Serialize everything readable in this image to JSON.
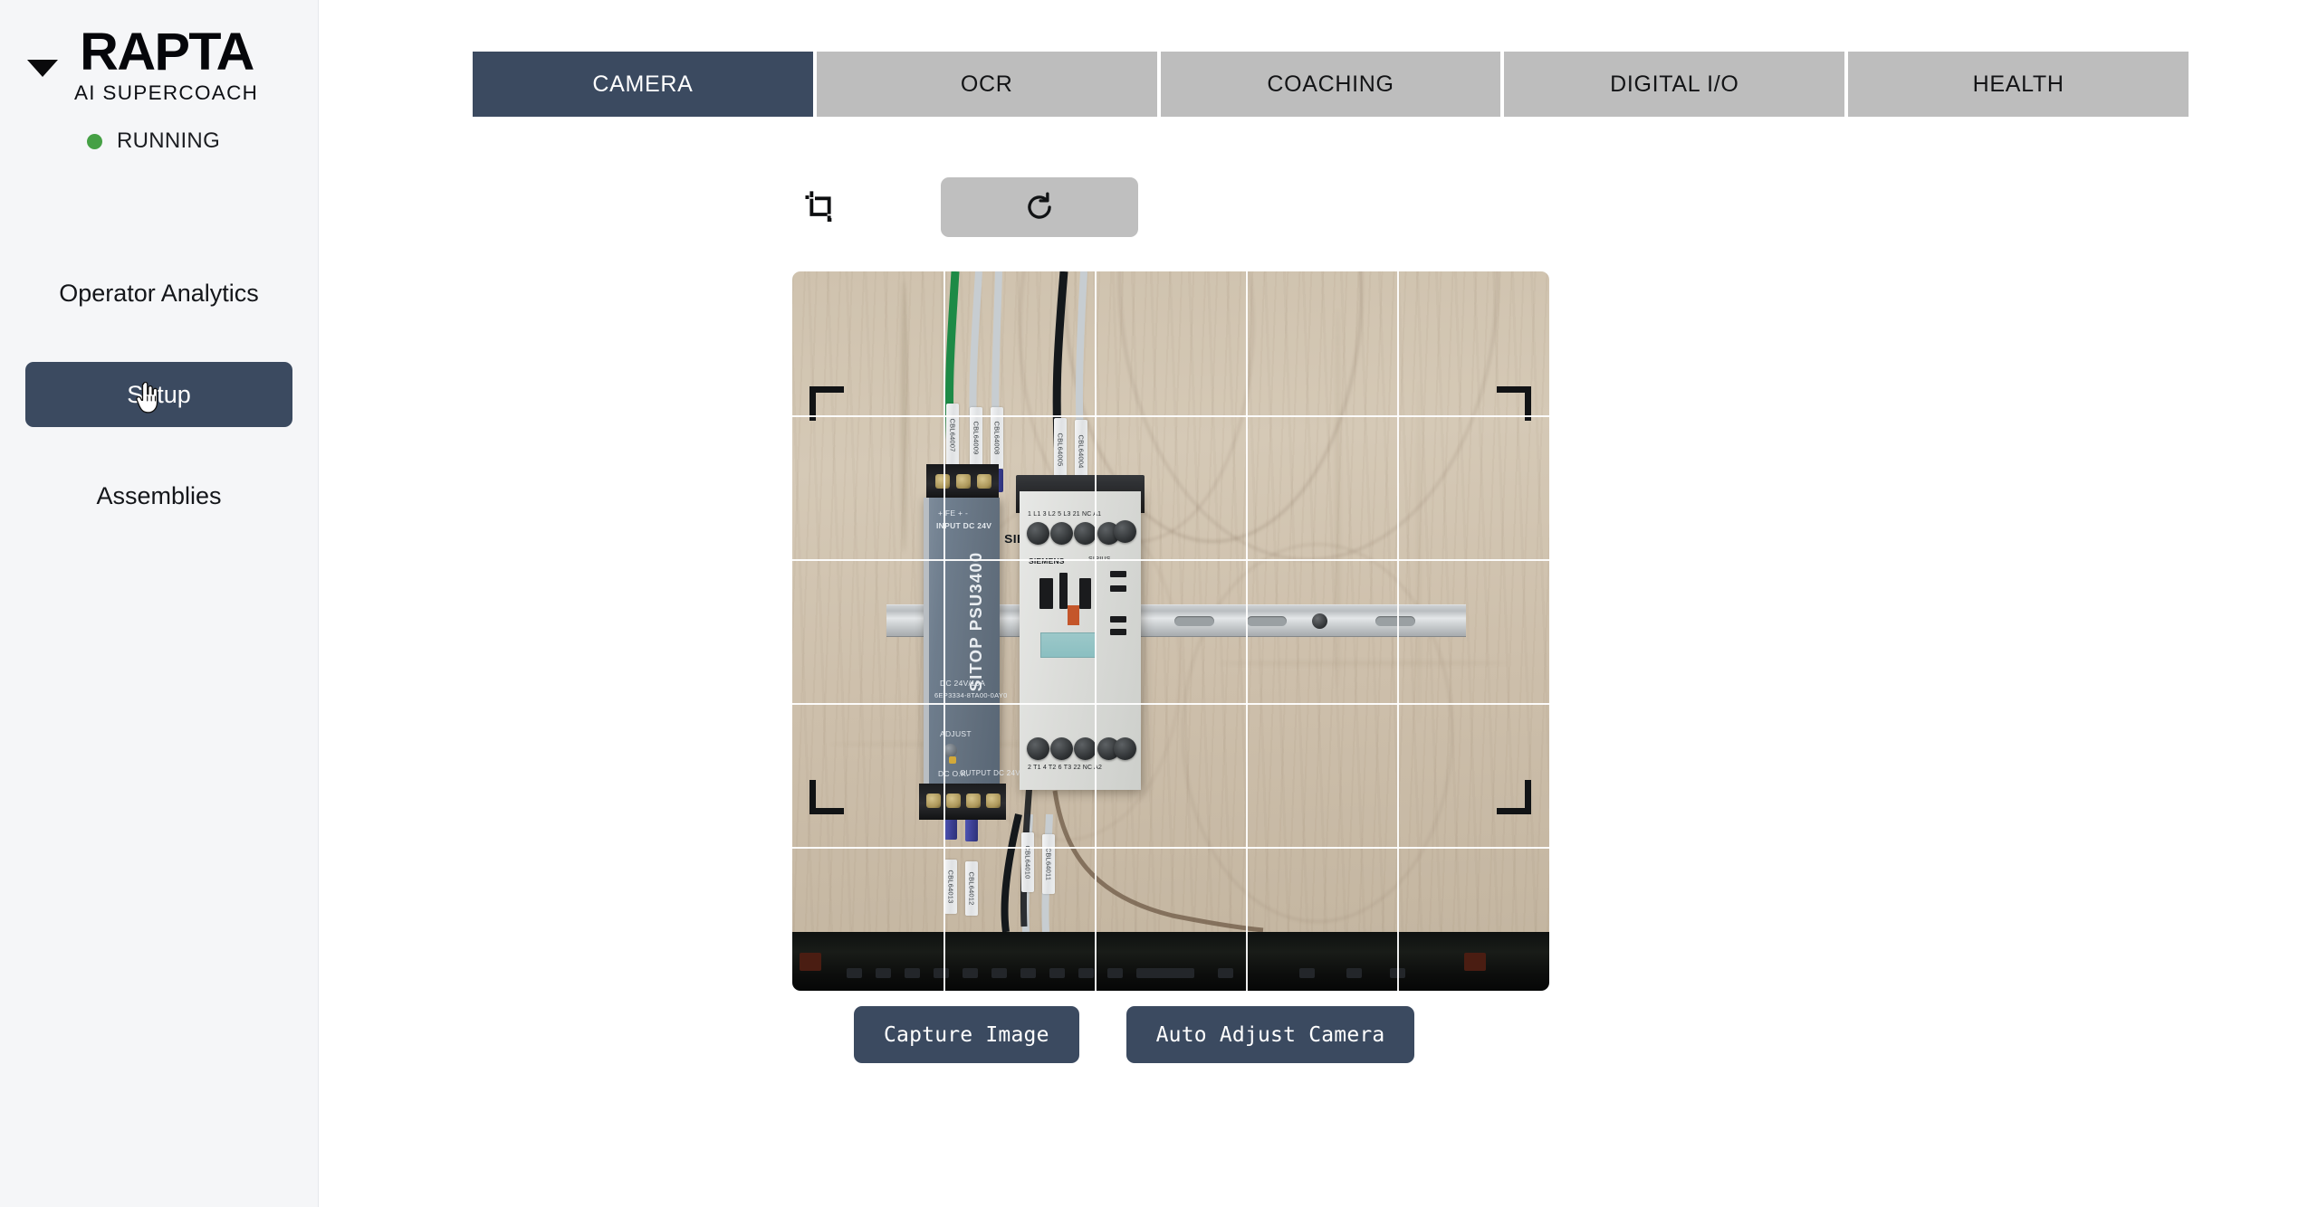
{
  "sidebar": {
    "collapse_icon": "chevron-down-icon",
    "logo_word": "RAPTA",
    "logo_sub": "AI SUPERCOACH",
    "status": {
      "label": "RUNNING",
      "color": "#45a045"
    },
    "nav_items": [
      {
        "label": "Operator Analytics",
        "active": false
      },
      {
        "label": "Setup",
        "active": true
      },
      {
        "label": "Assemblies",
        "active": false
      }
    ],
    "cursor": "pointing-hand-cursor"
  },
  "tabs": [
    {
      "label": "CAMERA",
      "active": true
    },
    {
      "label": "OCR",
      "active": false
    },
    {
      "label": "COACHING",
      "active": false
    },
    {
      "label": "DIGITAL I/O",
      "active": false
    },
    {
      "label": "HEALTH",
      "active": false
    }
  ],
  "toolbar": {
    "crop_icon": "crop-icon",
    "rotate_icon": "rotate-refresh-icon"
  },
  "camera": {
    "grid": {
      "columns": 5,
      "rows": 5,
      "line_color": "#ffffff"
    },
    "corner_markers": 4,
    "scene_labels": {
      "psu_model": "SITOP PSU3400",
      "psu_brand": "SIEMENS",
      "psu_input": "INPUT DC 24V",
      "psu_output": "OUTPUT DC 24V/10A",
      "psu_rating": "DC 24V/10A",
      "psu_partno": "6EP3334-8TA00-0AY0",
      "psu_adjust": "ADJUST",
      "psu_dcok": "DC O.K.",
      "psu_terminals": "+ FE + -",
      "contactor_brand": "SIEMENS",
      "contactor_series": "SIRIUS",
      "contactor_top_terms": "1 L1   3 L2   5 L3   21 NC   A1",
      "contactor_bot_terms": "2 T1   4 T2   6 T3   22 NC   A2"
    },
    "cable_labels": [
      "CBL64007",
      "CBL64009",
      "CBL64008",
      "CBL64005",
      "CBL64004",
      "CBL64010",
      "CBL64011",
      "CBL64013",
      "CBL64012"
    ]
  },
  "actions": {
    "capture": "Capture Image",
    "auto_adjust": "Auto Adjust Camera"
  }
}
